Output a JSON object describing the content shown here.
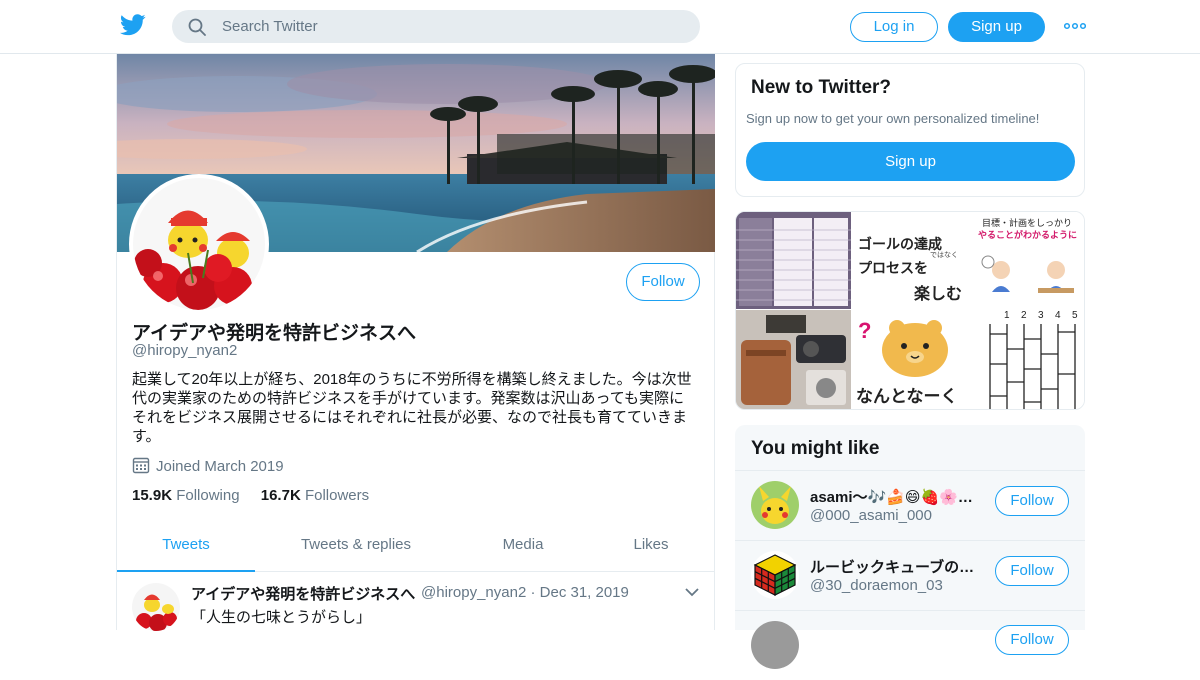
{
  "header": {
    "search_placeholder": "Search Twitter",
    "login_label": "Log in",
    "signup_label": "Sign up"
  },
  "profile": {
    "name": "アイデアや発明を特許ビジネスへ",
    "handle": "@hiropy_nyan2",
    "follow_label": "Follow",
    "bio": "起業して20年以上が経ち、2018年のうちに不労所得を構築し終えました。今は次世代の実業家のための特許ビジネスを手がけています。発案数は沢山あっても実際にそれをビジネス展開させるにはそれぞれに社長が必要、なので社長も育てていきます。",
    "joined": "Joined March 2019",
    "following_count": "15.9K",
    "following_label": "Following",
    "followers_count": "16.7K",
    "followers_label": "Followers"
  },
  "tabs": [
    "Tweets",
    "Tweets & replies",
    "Media",
    "Likes"
  ],
  "tweet": {
    "author": "アイデアや発明を特許ビジネスへ",
    "handle": "@hiropy_nyan2",
    "separator": "·",
    "date": "Dec 31, 2019",
    "text": "「人生の七味とうがらし」"
  },
  "new_to_twitter": {
    "title": "New to Twitter?",
    "subtitle": "Sign up now to get your own personalized timeline!",
    "signup_label": "Sign up"
  },
  "media_grid": {
    "goal_text_1": "ゴールの達成",
    "goal_text_2": "プロセスを",
    "goal_text_3": "楽しむ",
    "goal_text_small": "ではなく",
    "plan_text_1": "目標・計画をしっかり",
    "plan_text_2": "やることがわかるように",
    "bear_text": "なんとなーく",
    "ladder_numbers": [
      "1",
      "2",
      "3",
      "4",
      "5"
    ]
  },
  "you_might_like": {
    "title": "You might like",
    "accounts": [
      {
        "name": "asami〜🎶🍰😄🍓🌸…",
        "handle": "@000_asami_000",
        "follow_label": "Follow"
      },
      {
        "name": "ルービックキューブの…",
        "handle": "@30_doraemon_03",
        "follow_label": "Follow"
      },
      {
        "name": "",
        "handle": "",
        "follow_label": "Follow"
      }
    ]
  },
  "colors": {
    "accent": "#1da1f2",
    "secondary_text": "#657786",
    "border": "#e6ecf0",
    "panel_bg": "#f5f8fa"
  },
  "icons": [
    "twitter-bird-icon",
    "search-icon",
    "more-dots-icon",
    "calendar-icon",
    "chevron-down-icon"
  ]
}
